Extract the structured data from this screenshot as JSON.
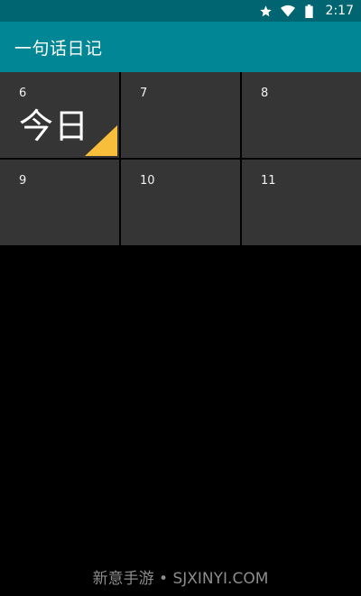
{
  "status_bar": {
    "icons": [
      "star-icon",
      "wifi-icon",
      "battery-icon"
    ],
    "time": "2:17"
  },
  "app_bar": {
    "title": "一句话日记"
  },
  "calendar": {
    "cells": [
      {
        "day": "6",
        "today_label": "今日",
        "is_today": true
      },
      {
        "day": "7"
      },
      {
        "day": "8"
      },
      {
        "day": "9"
      },
      {
        "day": "10"
      },
      {
        "day": "11"
      }
    ]
  },
  "watermark": {
    "text": "新意手游 • SJXINYI.COM"
  },
  "colors": {
    "status_bar": "#006570",
    "app_bar": "#008695",
    "cell_background": "#353535",
    "today_corner": "#F7BE3C",
    "background": "#000000"
  }
}
